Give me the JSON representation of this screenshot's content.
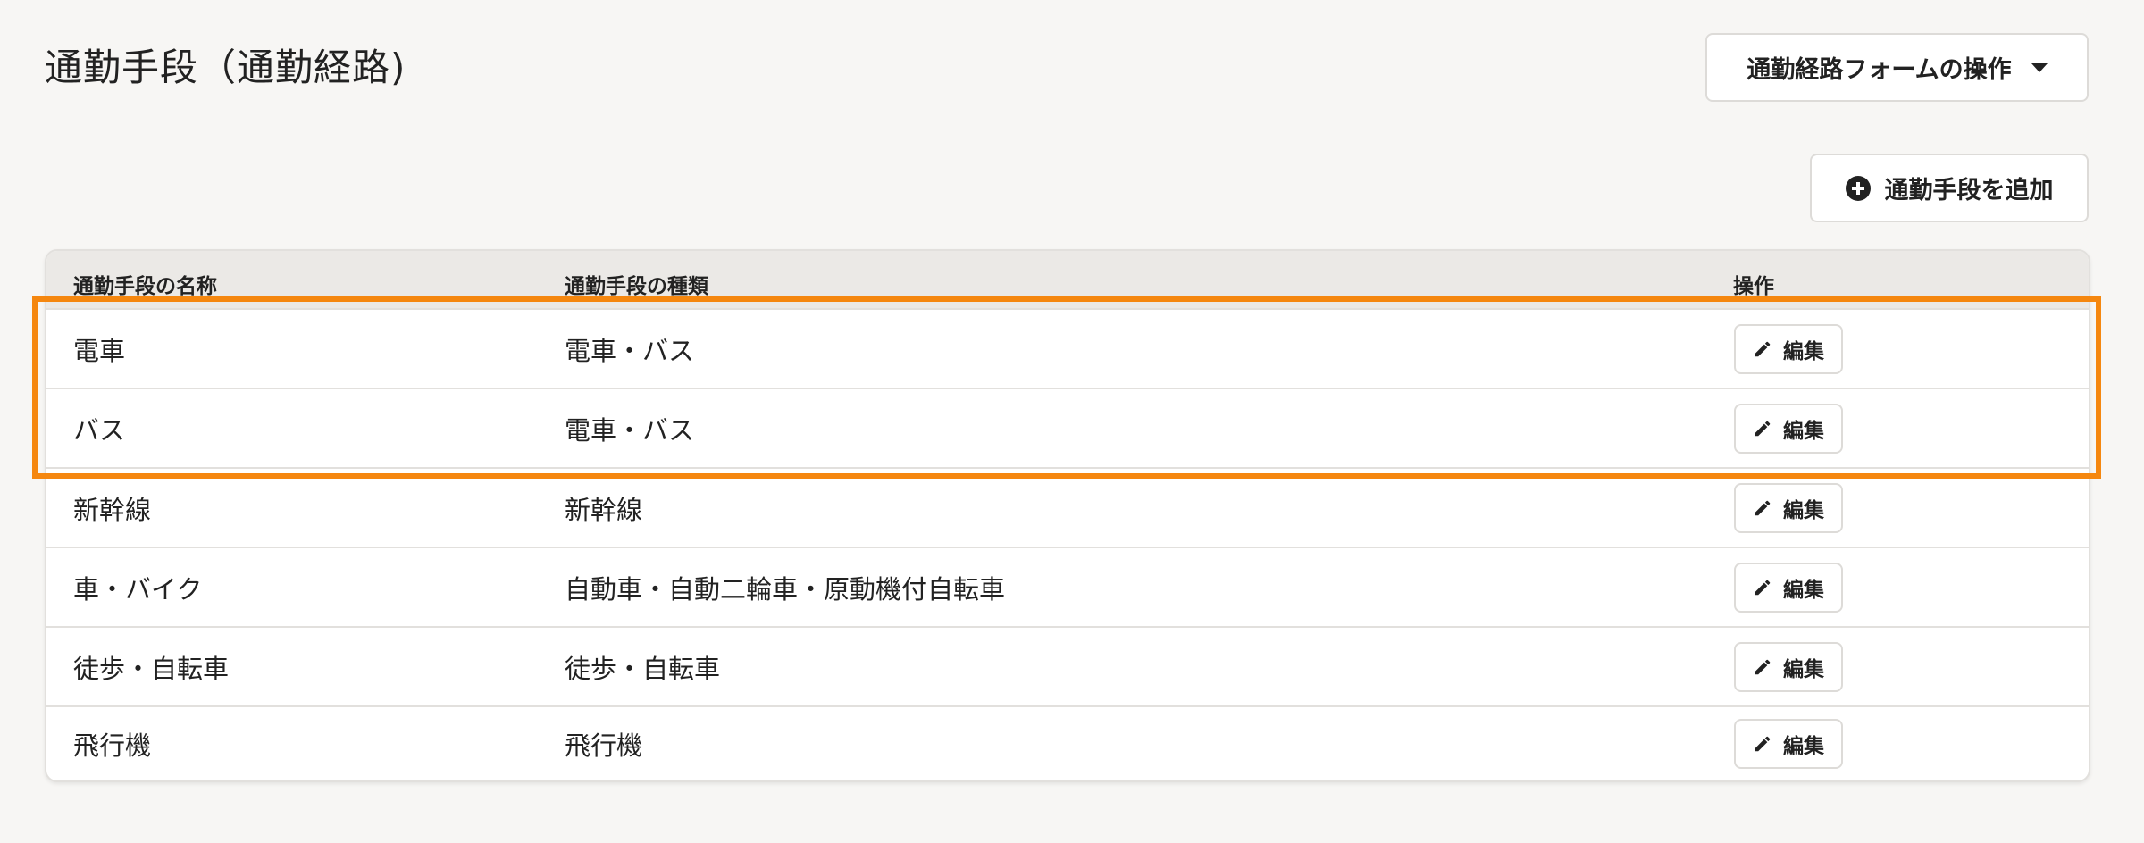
{
  "header": {
    "title": "通勤手段（通勤経路)",
    "form_ops_label": "通勤経路フォームの操作"
  },
  "toolbar": {
    "add_label": "通勤手段を追加"
  },
  "table": {
    "columns": [
      "通勤手段の名称",
      "通勤手段の種類",
      "操作"
    ],
    "rows": [
      {
        "name": "電車",
        "type": "電車・バス",
        "action": "編集"
      },
      {
        "name": "バス",
        "type": "電車・バス",
        "action": "編集"
      },
      {
        "name": "新幹線",
        "type": "新幹線",
        "action": "編集"
      },
      {
        "name": "車・バイク",
        "type": "自動車・自動二輪車・原動機付自転車",
        "action": "編集"
      },
      {
        "name": "徒歩・自転車",
        "type": "徒歩・自転車",
        "action": "編集"
      },
      {
        "name": "飛行機",
        "type": "飛行機",
        "action": "編集"
      }
    ]
  },
  "colors": {
    "highlight": "#f5870f",
    "background": "#f7f6f4",
    "header_bg": "#ebe9e6"
  },
  "icons": {
    "dropdown": "caret-down-icon",
    "add": "plus-circle-icon",
    "edit": "pencil-icon"
  }
}
